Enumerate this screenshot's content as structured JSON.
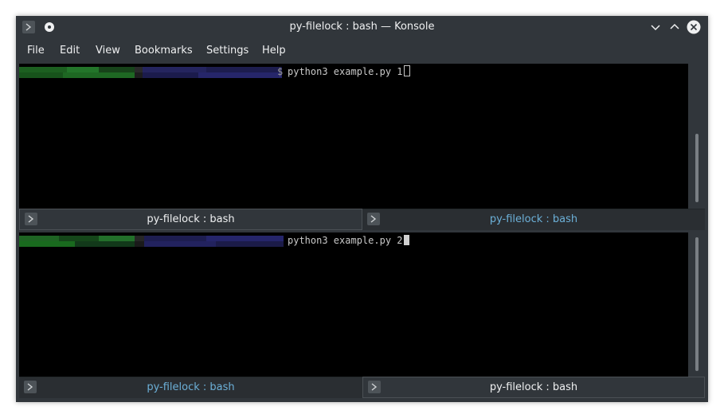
{
  "window": {
    "title": "py-filelock : bash — Konsole",
    "icons": [
      "app-icon",
      "pin-icon",
      "minimize-icon",
      "maximize-icon",
      "close-icon"
    ]
  },
  "menu": {
    "file": "File",
    "edit": "Edit",
    "view": "View",
    "bookmarks": "Bookmarks",
    "settings": "Settings",
    "help": "Help"
  },
  "panes": {
    "top": {
      "prompt_symbol": "$",
      "command": "python3 example.py 1",
      "cursor": "hollow",
      "tabs": [
        {
          "label": "py-filelock : bash",
          "state": "active"
        },
        {
          "label": "py-filelock : bash",
          "state": "inactive"
        }
      ]
    },
    "bottom": {
      "command": "python3 example.py 2",
      "cursor": "solid",
      "tabs": [
        {
          "label": "py-filelock : bash",
          "state": "inactive"
        },
        {
          "label": "py-filelock : bash",
          "state": "active"
        }
      ]
    }
  },
  "colors": {
    "window_bg": "#31363b",
    "terminal_bg": "#000000",
    "inactive_tab_text": "#6cb0d8",
    "active_tab_text": "#eff0f1",
    "redacted_user": "#1f6e23",
    "redacted_host": "#2a2a6e"
  }
}
